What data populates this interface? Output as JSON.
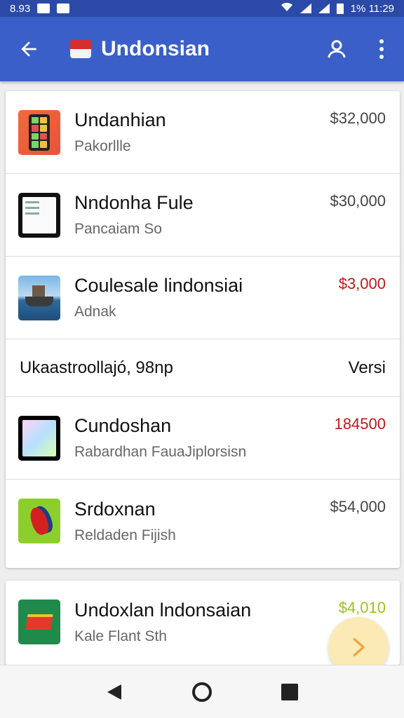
{
  "status_bar": {
    "left_text": "8.93",
    "right_text": "1% 11:29"
  },
  "app_bar": {
    "title": "Undonsian",
    "flag_icon": "indonesia-flag-icon",
    "back_icon": "arrow-back-icon",
    "account_icon": "account-icon",
    "more_icon": "more-vert-icon",
    "color": "#3a5fc8"
  },
  "listings": [
    {
      "title": "Undanhian",
      "subtitle": "Pakorllle",
      "price": "$32,000",
      "price_color": "grey",
      "thumb": "phone-thumbnail"
    },
    {
      "title": "Nndonha Fule",
      "subtitle": "Pancaiam So",
      "price": "$30,000",
      "price_color": "grey",
      "thumb": "tablet-thumbnail"
    },
    {
      "title": "Coulesale lindonsiai",
      "subtitle": "Adnak",
      "price": "$3,000",
      "price_color": "red",
      "thumb": "ship-thumbnail"
    },
    {
      "title": "Cundoshan",
      "subtitle": "Rabardhan FauaJiplorsisn",
      "price": "184500",
      "price_color": "red",
      "thumb": "tablet-thumbnail"
    },
    {
      "title": "Srdoxnan",
      "subtitle": "Reldaden Fijish",
      "price": "$54,000",
      "price_color": "grey",
      "thumb": "bird-thumbnail"
    }
  ],
  "summary_row": {
    "label": "Ukaastroollajó, 98np",
    "value": "Versi"
  },
  "second_card": {
    "title": "Undoxlan lndonsaian",
    "subtitle": "Kale Flant Sth",
    "price": "$4,010",
    "price_color": "green",
    "thumb": "flag-thumbnail"
  },
  "fab": {
    "icon": "chevron-right-icon"
  },
  "nav": {
    "back_icon": "nav-back-icon",
    "home_icon": "nav-home-icon",
    "recent_icon": "nav-recent-icon"
  },
  "colors": {
    "status_bar": "#2b4aa8",
    "price_red": "#c21818",
    "price_green": "#9bc31a",
    "fab": "#fbeab6"
  }
}
